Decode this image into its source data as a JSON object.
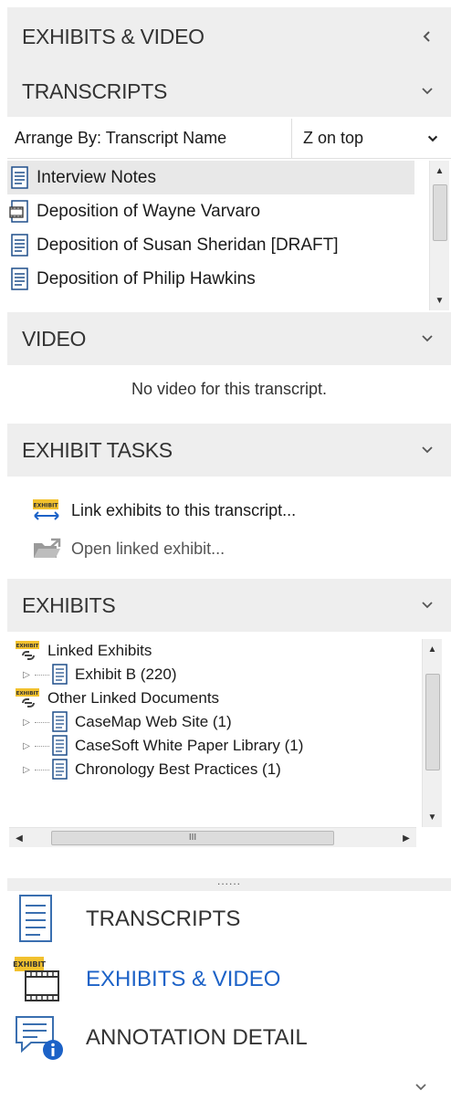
{
  "panel": {
    "title": "EXHIBITS & VIDEO"
  },
  "transcripts": {
    "title": "TRANSCRIPTS",
    "arrange_by": "Arrange By: Transcript Name",
    "order": "Z on top",
    "items": [
      {
        "label": "Interview Notes",
        "selected": true
      },
      {
        "label": "Deposition of Wayne Varvaro",
        "selected": false
      },
      {
        "label": "Deposition of Susan Sheridan [DRAFT]",
        "selected": false
      },
      {
        "label": "Deposition of Philip Hawkins",
        "selected": false
      }
    ]
  },
  "video": {
    "title": "VIDEO",
    "message": "No video for this transcript."
  },
  "exhibit_tasks": {
    "title": "EXHIBIT TASKS",
    "link_label": "Link exhibits to this transcript...",
    "open_label": "Open linked exhibit..."
  },
  "exhibits": {
    "title": "EXHIBITS",
    "group1": "Linked Exhibits",
    "group1_items": [
      "Exhibit B (220)"
    ],
    "group2": "Other Linked Documents",
    "group2_items": [
      "CaseMap Web Site (1)",
      "CaseSoft White Paper Library (1)",
      "Chronology Best Practices (1)"
    ],
    "hscroll_grip": "III"
  },
  "splitter_grip": "......",
  "nav": {
    "transcripts": "TRANSCRIPTS",
    "exhibits_video": "EXHIBITS & VIDEO",
    "annotation_detail": "ANNOTATION DETAIL"
  },
  "badge_text": "EXHIBIT",
  "colors": {
    "accent": "#1c62c7",
    "badge": "#f2c12e",
    "header_bg": "#eeeeee"
  }
}
